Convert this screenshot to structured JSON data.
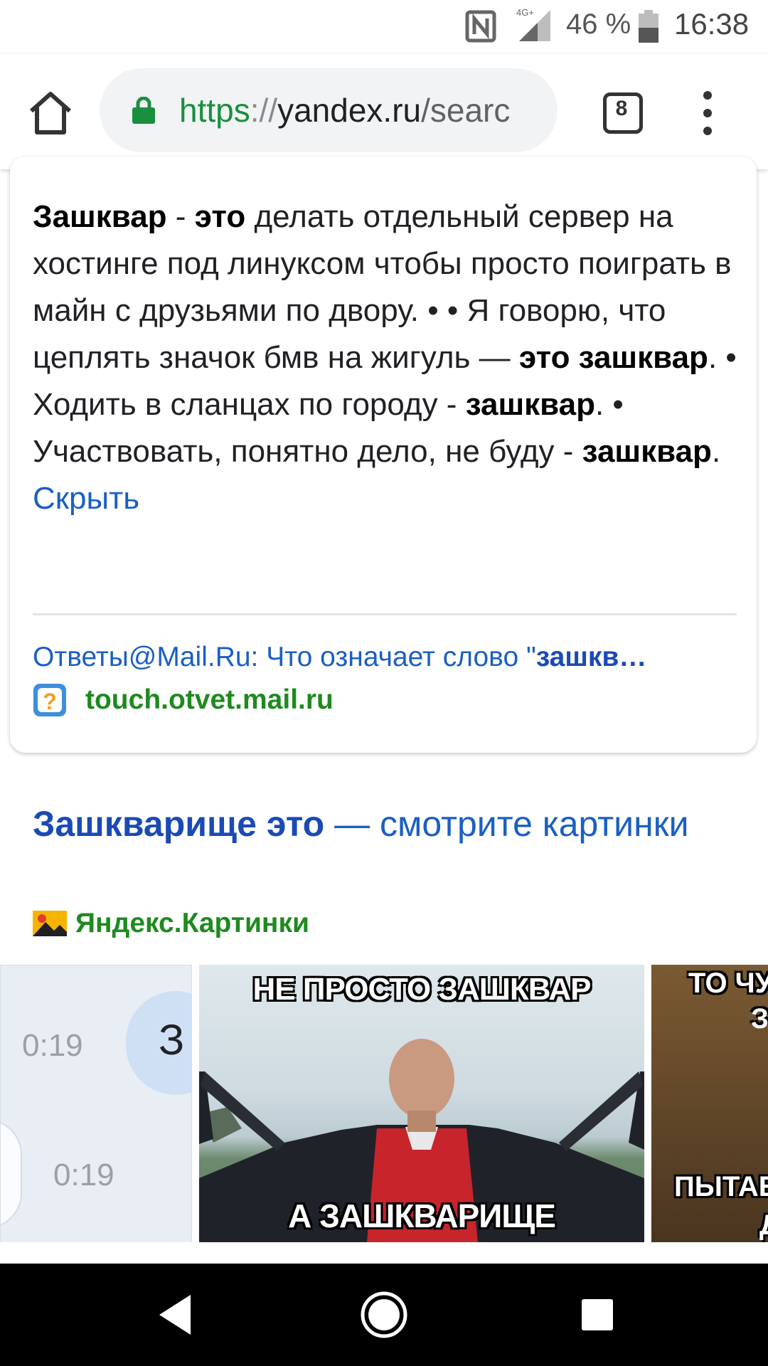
{
  "status_bar": {
    "network": "4G+",
    "battery_percent": "46 %",
    "time": "16:38"
  },
  "toolbar": {
    "url_scheme": "https",
    "url_separator": "://",
    "url_host": "yandex.ru",
    "url_path": "/searc",
    "tab_count": "8"
  },
  "answer": {
    "t01": "Зашквар",
    "t02": " - ",
    "t03": "это",
    "t04": " делать отдельный сервер на хостинге под линуксом чтобы просто поиграть в майн с друзьями по двору. • • Я говорю, что цеплять значок бмв на жигуль — ",
    "t05": "это зашквар",
    "t06": ". • Ходить в сланцах по городу - ",
    "t07": "зашквар",
    "t08": ". • Участвовать, понятно дело, не буду - ",
    "t09": "зашквар",
    "t10": ". ",
    "hide_link": "Скрыть",
    "source_title_prefix": "Ответы@Mail.Ru: Что означает слово \"",
    "source_title_bold": "зашкв…",
    "source_domain": "touch.otvet.mail.ru"
  },
  "images": {
    "title_bold": "Зашкварище это",
    "title_rest": " — смотрите картинки",
    "source_name": "Яндекс.Картинки",
    "thumb1": {
      "bubble_text": "З",
      "time_top": "0:19",
      "time_bottom": "0:19"
    },
    "thumb2": {
      "top_caption": "НЕ ПРОСТО ЗАШКВАР",
      "bottom_caption": "А ЗАШКВАРИЩЕ"
    },
    "thumb3": {
      "top_caption": "ТО ЧУВ",
      "mid_caption": "З",
      "bottom_caption": "ПЫТАЕТ",
      "bottom_caption_2": "Д"
    }
  },
  "colors": {
    "link_blue": "#1a5fc4",
    "source_green": "#1f8a1f",
    "secure_green": "#1a8f3f"
  }
}
